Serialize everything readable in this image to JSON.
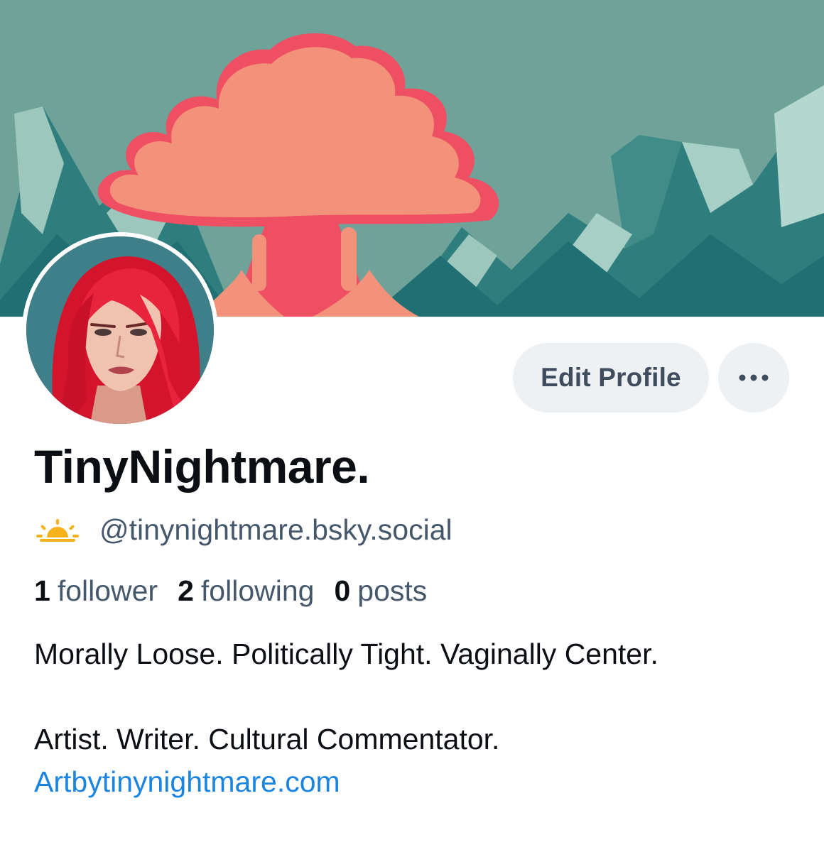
{
  "profile": {
    "display_name": "TinyNightmare.",
    "handle": "@tinynightmare.bsky.social",
    "status_icon": "sun-emoji-icon",
    "bio_line_1": "Morally Loose. Politically Tight. Vaginally Center.",
    "bio_line_2": "Artist. Writer. Cultural Commentator.",
    "website": "Artbytinynightmare.com"
  },
  "actions": {
    "edit_profile": "Edit Profile",
    "more_icon": "ellipsis-icon"
  },
  "stats": [
    {
      "count": "1",
      "label": "follower"
    },
    {
      "count": "2",
      "label": "following"
    },
    {
      "count": "0",
      "label": "posts"
    }
  ],
  "colors": {
    "banner_bg": "#6fa39a",
    "mushroom_cloud": "#f3927b",
    "link": "#1a84e0",
    "secondary_text": "#45576b",
    "pill_bg": "#eef1f4"
  }
}
